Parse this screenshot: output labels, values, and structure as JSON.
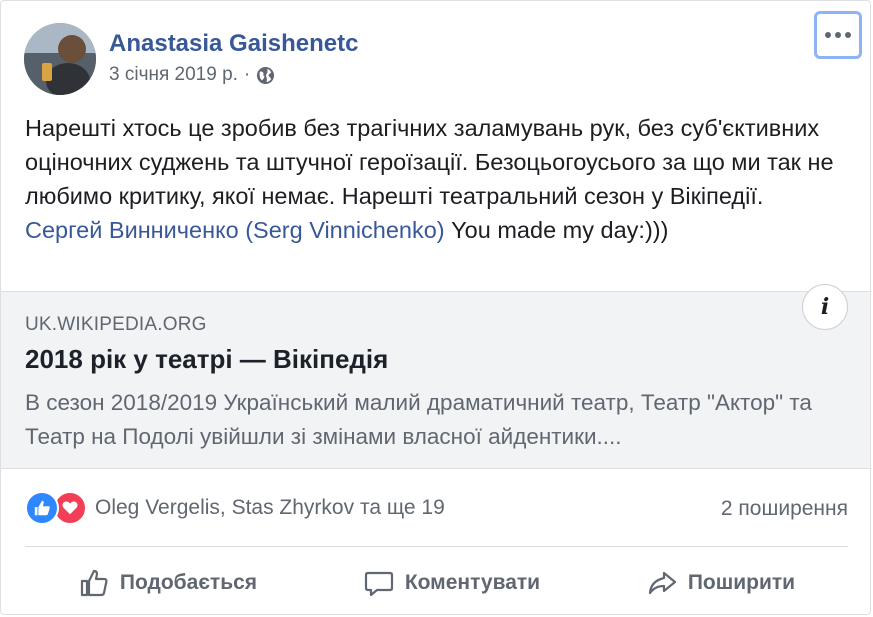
{
  "post": {
    "author": "Anastasia Gaishenetc",
    "date": "3 січня 2019 р.",
    "separator": "·",
    "privacy_icon": "globe-icon",
    "more_icon": "more-horizontal-icon",
    "text_main": "Нарешті хтось це зробив без трагічних заламувань рук, без суб'єктивних оціночних суджень та штучної героїзації. Безоцьогоусього за що ми так не любимо критику, якої немає. Нарешті театральний сезон у Вікіпедії. ",
    "mention": "Сергей Винниченко (Serg Vinnichenko)",
    "text_tail": " You made my day:)))"
  },
  "preview": {
    "domain": "UK.WIKIPEDIA.ORG",
    "title": "2018 рік у театрі — Вікіпедія",
    "description": "В сезон 2018/2019 Український малий драматичний театр, Театр \"Актор\" та Театр на Подолі увійшли зі змінами власної айдентики....",
    "info_label": "i"
  },
  "stats": {
    "reaction_icons": [
      "like-reaction-icon",
      "love-reaction-icon"
    ],
    "reactors": "Oleg Vergelis, Stas Zhyrkov та ще 19",
    "shares": "2 поширення"
  },
  "actions": {
    "like": "Подобається",
    "comment": "Коментувати",
    "share": "Поширити"
  },
  "colors": {
    "link": "#385898",
    "secondary_text": "#606770",
    "like_blue": "#2d88ff",
    "love_red": "#f33e58",
    "focus_ring": "#8fb4f5"
  }
}
